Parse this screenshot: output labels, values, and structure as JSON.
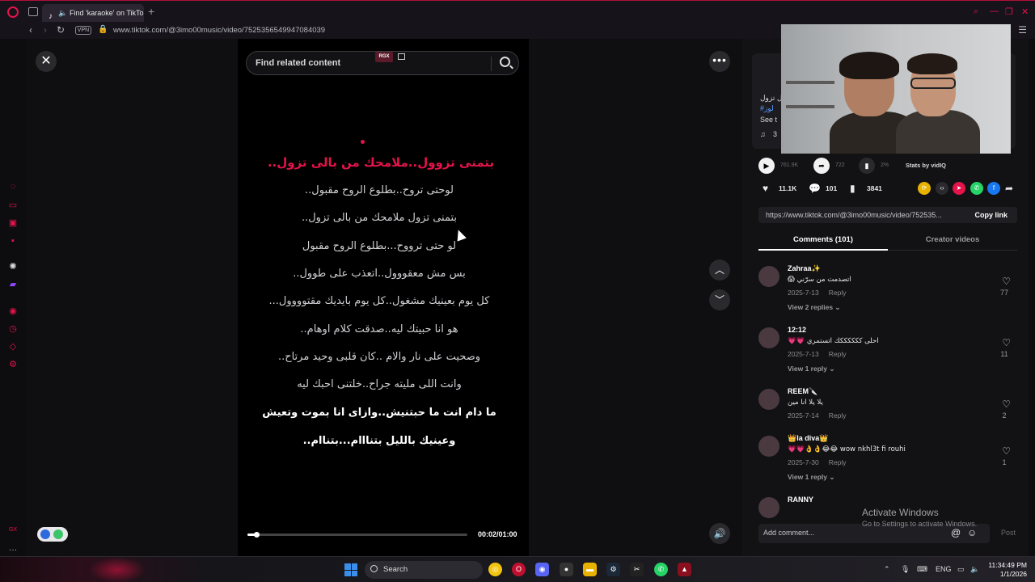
{
  "browser": {
    "tab_title": "Find 'karaoke' on TikTo",
    "url": "www.tiktok.com/@3imo00music/video/7525356549947084039",
    "vpn_label": "VPN"
  },
  "video": {
    "search_placeholder": "Find related content",
    "rgx_label": "RGX",
    "lyrics_title": "بتمنى تزوول..ملامحك من بالى تزول..",
    "lyrics": [
      "لوحتى تروح..بطلوع الروح مقبول..",
      "بتمنى تزول ملامحك من بالى تزول..",
      "لو حتى ترووح...بطلوع الروح مقبول",
      "بس مش معقووول..اتعذب على طوول..",
      "كل يوم بعينيك مشغول..كل يوم بايديك مقتوووول...",
      "هو انا حبيتك ليه..صدقت كلام اوهام..",
      "وصحيت على نار والام ..كان قلبى وحيد مرتاح..",
      "وانت اللى مليته جراح..خلتنى احبك ليه",
      "ما دام انت ما حبتنيش..وازاى انا بموت وتعيش",
      "وعينيك بالليل بتنااام...بتناام.."
    ],
    "time": "00:02/01:00",
    "progress": 0.04
  },
  "author": {
    "caption_line1": "ل تزول",
    "caption_line2": "#لوز",
    "see_more": "See t",
    "music_count": "3"
  },
  "stats": {
    "plays": "761.9K",
    "shares_small": "722",
    "percent": "2%",
    "stats_by": "Stats by vidIQ",
    "likes": "11.1K",
    "comments": "101",
    "saves": "3841"
  },
  "link": {
    "url": "https://www.tiktok.com/@3imo00music/video/752535...",
    "copy_label": "Copy link"
  },
  "tabs": {
    "comments": "Comments (101)",
    "creator": "Creator videos"
  },
  "comments": [
    {
      "user": "Zahraa✨",
      "text": "😱 اتصدمت من سرّني",
      "date": "2025-7-13",
      "reply": "Reply",
      "likes": "77",
      "replies": "View 2 replies ⌄"
    },
    {
      "user": "12:12",
      "text": "💗💗 احلى ككككككك اتستمري",
      "date": "2025-7-13",
      "reply": "Reply",
      "likes": "11",
      "replies": "View 1 reply ⌄"
    },
    {
      "user": "REEM🔪",
      "text": "يلا يلا انا مين",
      "date": "2025-7-14",
      "reply": "Reply",
      "likes": "2",
      "replies": ""
    },
    {
      "user": "👑la diva👑",
      "text": "💗💗👌👌😂😂 wow nkhl3t fi rouhi",
      "date": "2025-7-30",
      "reply": "Reply",
      "likes": "1",
      "replies": "View 1 reply ⌄"
    },
    {
      "user": "RANNY",
      "text": "",
      "date": "",
      "reply": "",
      "likes": "",
      "replies": ""
    }
  ],
  "comment_bar": {
    "placeholder": "Add comment...",
    "post": "Post"
  },
  "windows": {
    "activate_title": "Activate Windows",
    "activate_sub": "Go to Settings to activate Windows.",
    "search": "Search",
    "lang": "ENG",
    "time": "11:34:49 PM",
    "date": "1/1/2026"
  },
  "colors": {
    "accent": "#e4134a",
    "background": "#0f0f11"
  }
}
